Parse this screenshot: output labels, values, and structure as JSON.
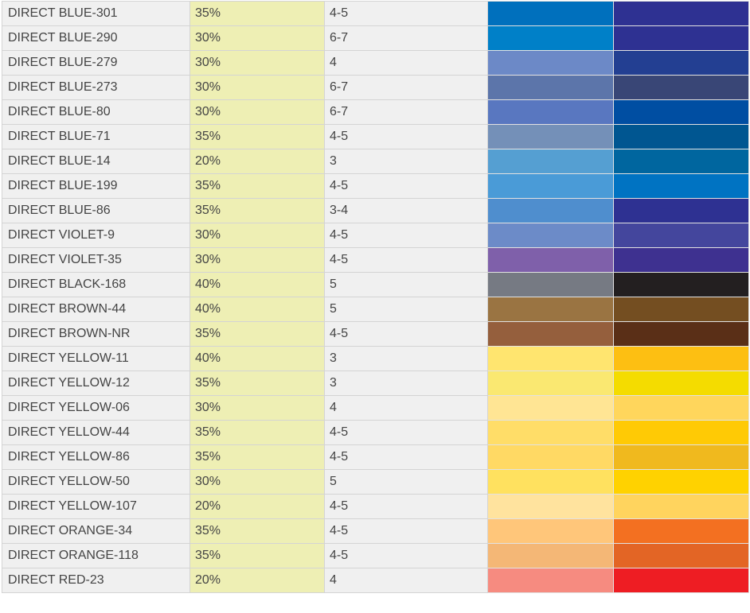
{
  "rows": [
    {
      "name": "DIRECT BLUE-301",
      "strength": "35%",
      "fastness": "4-5",
      "light_color": "#0070BD",
      "dark_color": "#2E3192"
    },
    {
      "name": "DIRECT BLUE-290",
      "strength": "30%",
      "fastness": "6-7",
      "light_color": "#0080C8",
      "dark_color": "#2E3192"
    },
    {
      "name": "DIRECT BLUE-279",
      "strength": "30%",
      "fastness": "4",
      "light_color": "#6C89C7",
      "dark_color": "#233F92"
    },
    {
      "name": "DIRECT BLUE-273",
      "strength": "30%",
      "fastness": "6-7",
      "light_color": "#5C75AA",
      "dark_color": "#394676"
    },
    {
      "name": "DIRECT BLUE-80",
      "strength": "30%",
      "fastness": "6-7",
      "light_color": "#5977C0",
      "dark_color": "#004EA2"
    },
    {
      "name": "DIRECT BLUE-71",
      "strength": "35%",
      "fastness": "4-5",
      "light_color": "#7490B8",
      "dark_color": "#005691"
    },
    {
      "name": "DIRECT BLUE-14",
      "strength": "20%",
      "fastness": "3",
      "light_color": "#559FD2",
      "dark_color": "#00669F"
    },
    {
      "name": "DIRECT BLUE-199",
      "strength": "35%",
      "fastness": "4-5",
      "light_color": "#4A9BD7",
      "dark_color": "#0073C2"
    },
    {
      "name": "DIRECT BLUE-86",
      "strength": "35%",
      "fastness": "3-4",
      "light_color": "#4F8ECE",
      "dark_color": "#2E3192"
    },
    {
      "name": "DIRECT VIOLET-9",
      "strength": "30%",
      "fastness": "4-5",
      "light_color": "#6C8BC8",
      "dark_color": "#44469D"
    },
    {
      "name": "DIRECT VIOLET-35",
      "strength": "30%",
      "fastness": "4-5",
      "light_color": "#7F60AA",
      "dark_color": "#3E3190"
    },
    {
      "name": "DIRECT BLACK-168",
      "strength": "40%",
      "fastness": "5",
      "light_color": "#767A83",
      "dark_color": "#231F20"
    },
    {
      "name": "DIRECT BROWN-44",
      "strength": "40%",
      "fastness": "5",
      "light_color": "#9A7442",
      "dark_color": "#744E21"
    },
    {
      "name": "DIRECT BROWN-NR",
      "strength": "35%",
      "fastness": "4-5",
      "light_color": "#955F3D",
      "dark_color": "#5A2F17"
    },
    {
      "name": "DIRECT YELLOW-11",
      "strength": "40%",
      "fastness": "3",
      "light_color": "#FFE56F",
      "dark_color": "#FDBF12"
    },
    {
      "name": "DIRECT YELLOW-12",
      "strength": "35%",
      "fastness": "3",
      "light_color": "#FAE871",
      "dark_color": "#F4DC00"
    },
    {
      "name": "DIRECT YELLOW-06",
      "strength": "30%",
      "fastness": "4",
      "light_color": "#FFE594",
      "dark_color": "#FFD65C"
    },
    {
      "name": "DIRECT YELLOW-44",
      "strength": "35%",
      "fastness": "4-5",
      "light_color": "#FFDD68",
      "dark_color": "#FFCA05"
    },
    {
      "name": "DIRECT YELLOW-86",
      "strength": "35%",
      "fastness": "4-5",
      "light_color": "#FFD964",
      "dark_color": "#F0B91E"
    },
    {
      "name": "DIRECT YELLOW-50",
      "strength": "30%",
      "fastness": "5",
      "light_color": "#FFE15F",
      "dark_color": "#FFD200"
    },
    {
      "name": "DIRECT YELLOW-107",
      "strength": "20%",
      "fastness": "4-5",
      "light_color": "#FFE39E",
      "dark_color": "#FFD45E"
    },
    {
      "name": "DIRECT ORANGE-34",
      "strength": "35%",
      "fastness": "4-5",
      "light_color": "#FFC67A",
      "dark_color": "#F37021"
    },
    {
      "name": "DIRECT ORANGE-118",
      "strength": "35%",
      "fastness": "4-5",
      "light_color": "#F4B776",
      "dark_color": "#E36525"
    },
    {
      "name": "DIRECT RED-23",
      "strength": "20%",
      "fastness": "4",
      "light_color": "#F68B80",
      "dark_color": "#EE1D23"
    }
  ]
}
